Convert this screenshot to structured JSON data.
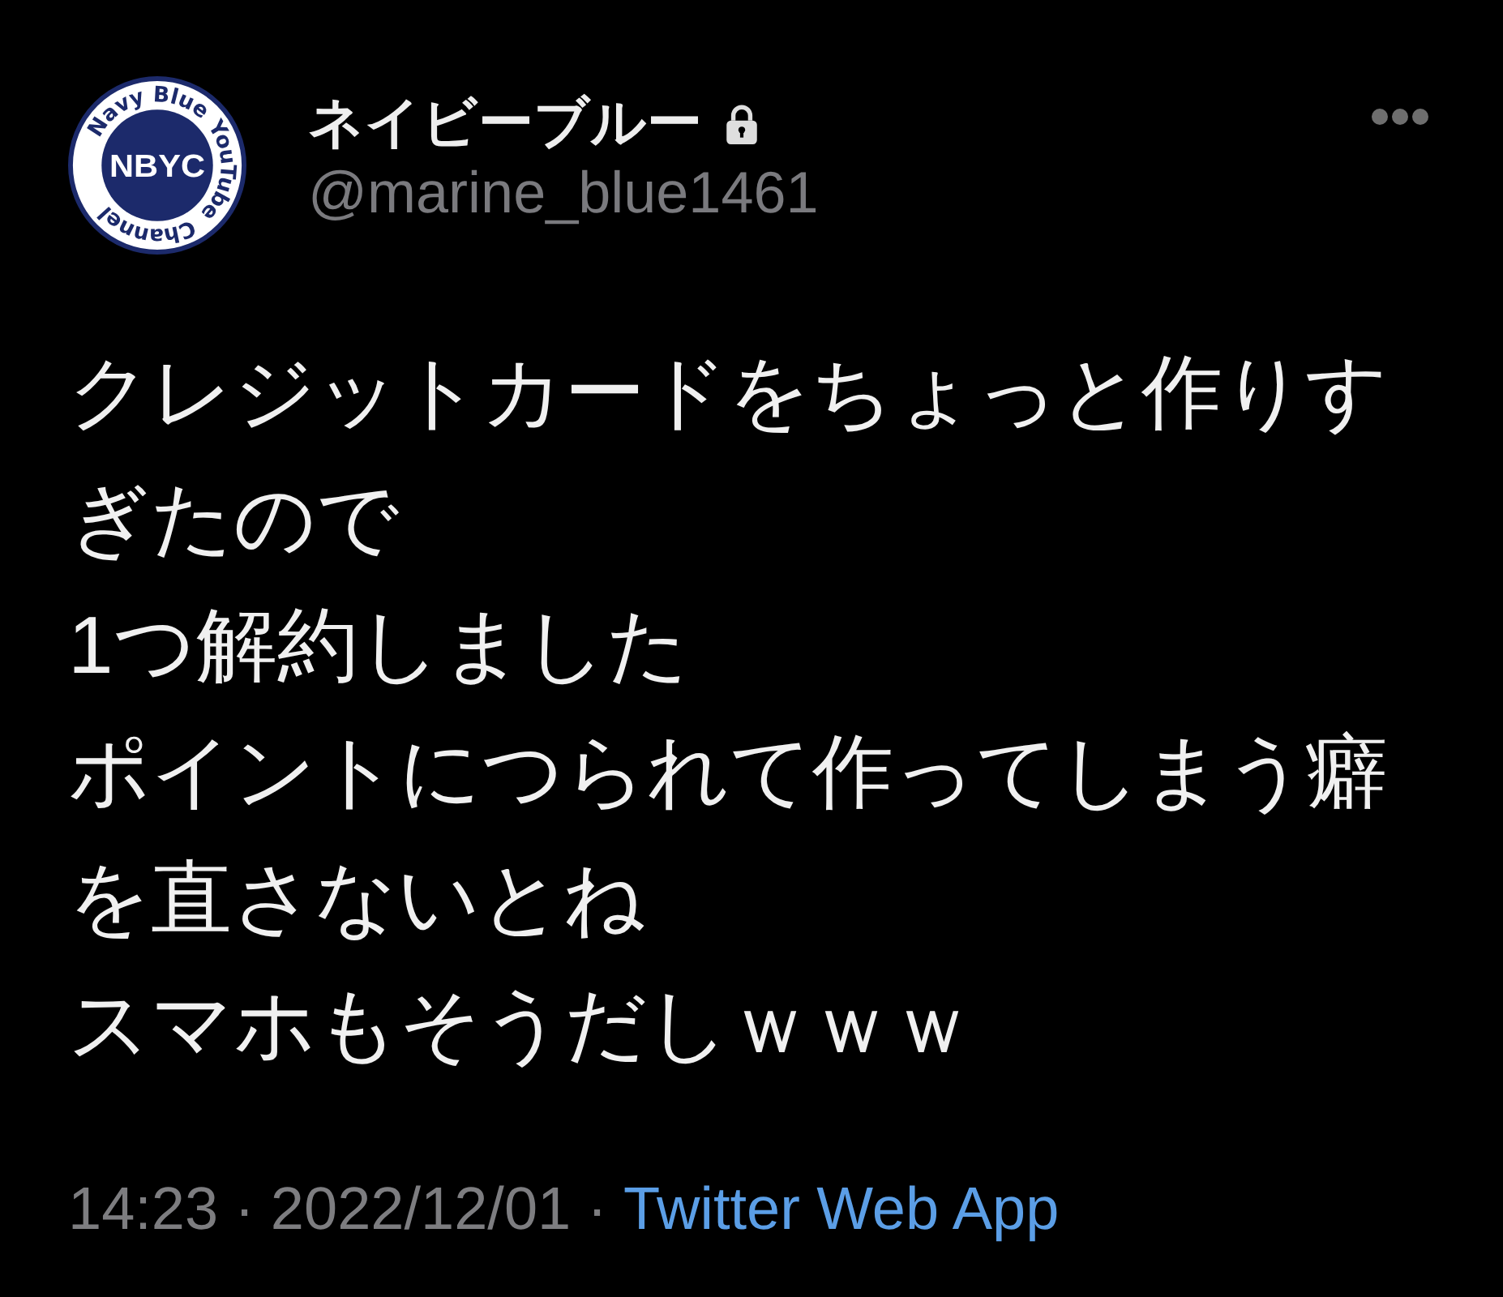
{
  "avatar": {
    "ring_words": [
      "Navy Blue",
      "YouTube",
      "Channel"
    ],
    "center_text": "NBYC"
  },
  "account": {
    "display_name": "ネイビーブルー",
    "protected": true,
    "handle": "@marine_blue1461"
  },
  "tweet": {
    "lines": [
      "クレジットカードをちょっと作りすぎたので",
      "1つ解約しました",
      "ポイントにつられて作ってしまう癖を直さないとね",
      "スマホもそうだしｗｗｗ"
    ]
  },
  "meta": [
    {
      "kind": "time",
      "text": "14:23"
    },
    {
      "kind": "separator",
      "text": "·"
    },
    {
      "kind": "date",
      "text": "2022/12/01"
    },
    {
      "kind": "separator",
      "text": "·"
    },
    {
      "kind": "source",
      "text": "Twitter Web App"
    }
  ]
}
